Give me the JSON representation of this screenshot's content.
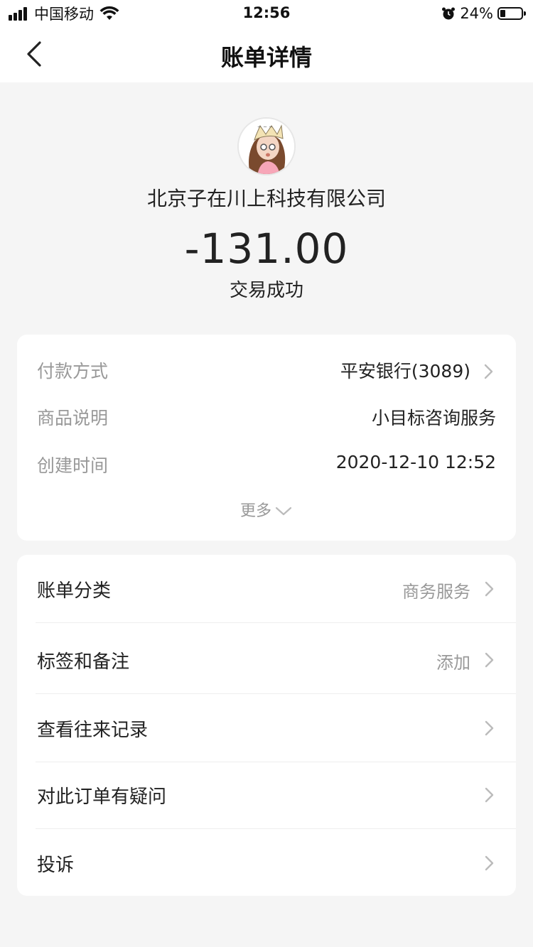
{
  "status_bar": {
    "carrier": "中国移动",
    "time": "12:56",
    "battery": "24%"
  },
  "nav": {
    "title": "账单详情"
  },
  "transaction": {
    "merchant": "北京子在川上科技有限公司",
    "amount": "-131.00",
    "status": "交易成功"
  },
  "details": [
    {
      "label": "付款方式",
      "value": "平安银行(3089)"
    },
    {
      "label": "商品说明",
      "value": "小目标咨询服务"
    },
    {
      "label": "创建时间",
      "value": "2020-12-10 12:52"
    }
  ],
  "more_label": "更多",
  "actions": [
    {
      "label": "账单分类",
      "value": "商务服务"
    },
    {
      "label": "标签和备注",
      "value": "添加"
    },
    {
      "label": "查看往来记录",
      "value": ""
    },
    {
      "label": "对此订单有疑问",
      "value": ""
    },
    {
      "label": "投诉",
      "value": ""
    }
  ],
  "colors": {
    "background": "#f5f5f5",
    "card": "#ffffff",
    "text_primary": "#222222",
    "text_secondary": "#999999"
  },
  "icons": [
    "signal-icon",
    "wifi-icon",
    "alarm-icon",
    "battery-icon",
    "back-arrow-icon",
    "chevron-right-icon",
    "chevron-down-icon"
  ]
}
